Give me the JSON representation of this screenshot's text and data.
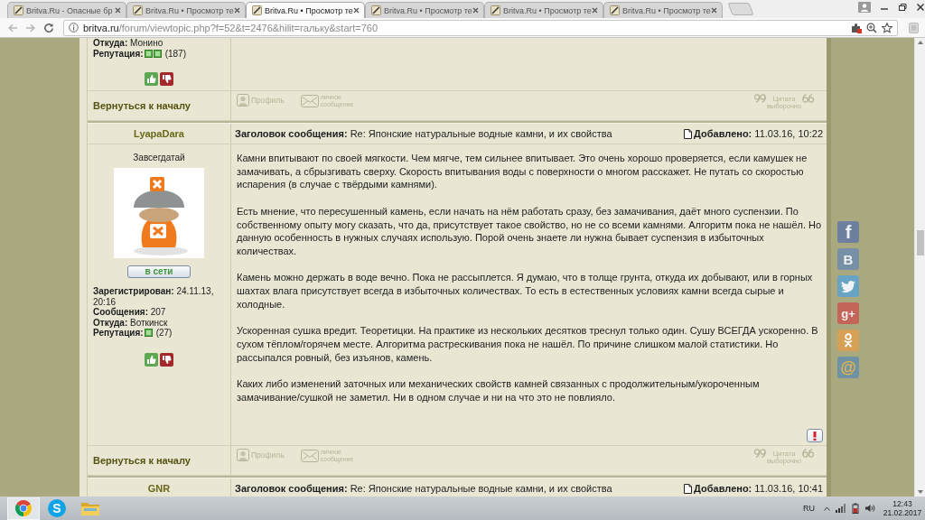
{
  "browser": {
    "tabs": [
      {
        "title": "Britva.Ru - Опасные бр",
        "selected": false
      },
      {
        "title": "Britva.Ru • Просмотр те",
        "selected": false
      },
      {
        "title": "Britva.Ru • Просмотр те",
        "selected": true
      },
      {
        "title": "Britva.Ru • Просмотр те",
        "selected": false
      },
      {
        "title": "Britva.Ru • Просмотр те",
        "selected": false
      },
      {
        "title": "Britva.Ru • Просмотр те",
        "selected": false
      }
    ],
    "address": "britva.ru/forum/viewtopic.php?f=52&t=2476&hilit=гальку&start=760"
  },
  "posts": [
    {
      "kind": "tail",
      "author": {
        "details": [
          "**Откуда:** Монино"
        ],
        "reputation": {
          "label": "Репутация:",
          "icons": [
            {
              "kind": "positive"
            },
            {
              "kind": "positive"
            }
          ],
          "count": "(187)"
        }
      },
      "back_link": "Вернуться к началу",
      "actions": [
        {
          "kind": "profile",
          "label": "Профиль"
        },
        {
          "kind": "message",
          "label": "личное сообщение"
        },
        {
          "kind": "quote",
          "label": "Цитата выборочно"
        }
      ]
    },
    {
      "kind": "full",
      "author": {
        "name": "LyapaDara",
        "rank": "Завсегдатай",
        "status": "в сети",
        "details": [
          "**Зарегистрирован:** 24.11.13, 20:16",
          "**Сообщения:** 207",
          "**Откуда:** Воткинск"
        ],
        "reputation": {
          "label": "Репутация:",
          "icons": [
            {
              "kind": "positive"
            }
          ],
          "count": "(27)"
        }
      },
      "subject": "**Заголовок сообщения:** Re: Японские натуральные водные камни, и их свойства",
      "added": "**Добавлено:** 11.03.16, 10:22",
      "paragraphs": [
        "Камни впитывают по своей мягкости. Чем мягче, тем сильнее впитывает. Это очень хорошо проверяется, если камушек не замачивать, а сбрызгивать сверху. Скорость впитывания воды с поверхности о многом расскажет. Не путать со скоростью испарения (в случае с твёрдыми камнями).",
        "Есть мнение, что пересушенный камень, если начать на нём работать сразу, без замачивания, даёт много суспензии. По собственному опыту могу сказать, что да, присутствует такое свойство, но не со всеми камнями. Алгоритм пока не нашёл. Но данную особенность в нужных случаях использую. Порой очень знаете ли нужна бывает суспензия в избыточных количествах.",
        "Камень можно держать в воде вечно. Пока не рассыплется. Я думаю, что в толще грунта, откуда их добывают, или в горных шахтах влага присутствует всегда в избыточных количествах. То есть в естественных условиях камни всегда сырые и холодные.",
        "Ускоренная сушка вредит. Теоретицки. На практике из нескольких десятков треснул только один. Сушу ВСЕГДА ускоренно. В сухом тёплом/горячем месте. Алгоритма растрескивания пока не нашёл. По причине слишком малой статистики. Но рассыпался ровный, без изъянов, камень.",
        "Каких либо изменений заточных или механических свойств камней связанных с продолжительным/укороченным замачивание/сушкой не заметил. Ни в одном случае и ни на что это не повлияло."
      ],
      "back_link": "Вернуться к началу",
      "actions": [
        {
          "kind": "profile",
          "label": "Профиль"
        },
        {
          "kind": "message",
          "label": "личное сообщение"
        },
        {
          "kind": "quote",
          "label": "Цитата выборочно"
        }
      ]
    },
    {
      "kind": "header",
      "author": {
        "name": "GNR"
      },
      "subject": "**Заголовок сообщения:** Re: Японские натуральные водные камни, и их свойства",
      "added": "**Добавлено:** 11.03.16, 10:41"
    }
  ],
  "share_buttons": [
    {
      "kind": "facebook",
      "glyph": "f"
    },
    {
      "kind": "vk",
      "glyph": "B"
    },
    {
      "kind": "twitter"
    },
    {
      "kind": "google_plus",
      "glyph": "g+"
    },
    {
      "kind": "odnoklassniki"
    },
    {
      "kind": "mail",
      "glyph": "@"
    }
  ],
  "taskbar": {
    "apps": [
      {
        "kind": "chrome",
        "selected": true
      },
      {
        "kind": "skype",
        "glyph": "S",
        "selected": false
      },
      {
        "kind": "explorer",
        "selected": false
      }
    ],
    "language": "RU",
    "time": "12:43",
    "date": "21.02.2017"
  }
}
